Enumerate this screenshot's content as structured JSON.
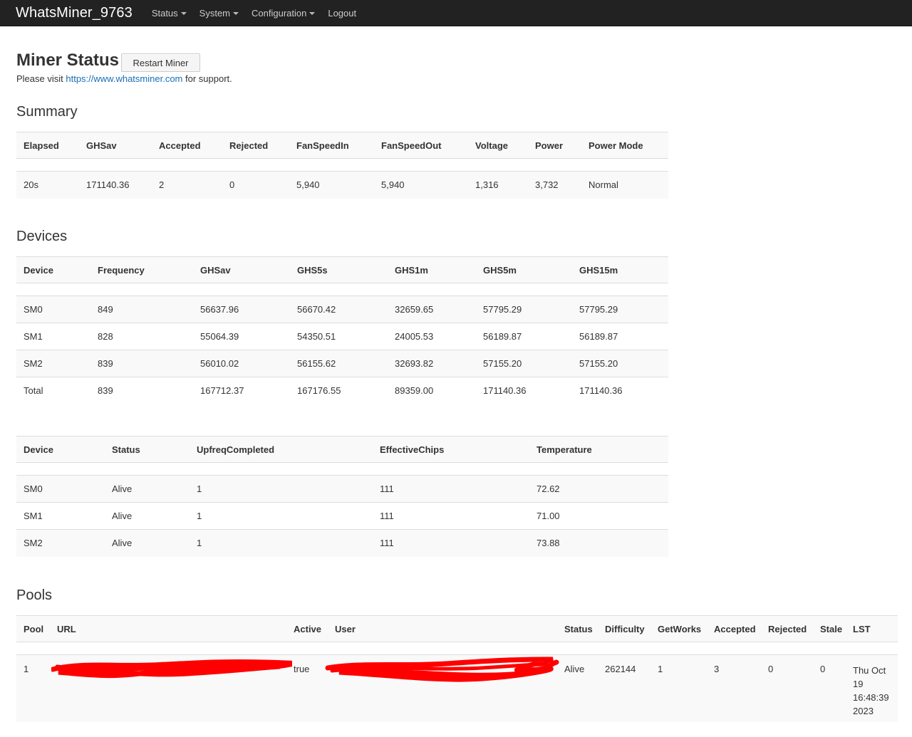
{
  "navbar": {
    "brand": "WhatsMiner_9763",
    "menu": [
      {
        "label": "Status",
        "dropdown": true
      },
      {
        "label": "System",
        "dropdown": true
      },
      {
        "label": "Configuration",
        "dropdown": true
      },
      {
        "label": "Logout",
        "dropdown": false
      }
    ]
  },
  "header": {
    "title": "Miner Status",
    "restart_label": "Restart Miner",
    "support_prefix": "Please visit ",
    "support_link": "https://www.whatsminer.com",
    "support_suffix": " for support."
  },
  "summary": {
    "title": "Summary",
    "columns": [
      "Elapsed",
      "GHSav",
      "Accepted",
      "Rejected",
      "FanSpeedIn",
      "FanSpeedOut",
      "Voltage",
      "Power",
      "Power Mode"
    ],
    "rows": [
      [
        "20s",
        "171140.36",
        "2",
        "0",
        "5,940",
        "5,940",
        "1,316",
        "3,732",
        "Normal"
      ]
    ]
  },
  "devices": {
    "title": "Devices",
    "columns": [
      "Device",
      "Frequency",
      "GHSav",
      "GHS5s",
      "GHS1m",
      "GHS5m",
      "GHS15m"
    ],
    "rows": [
      [
        "SM0",
        "849",
        "56637.96",
        "56670.42",
        "32659.65",
        "57795.29",
        "57795.29"
      ],
      [
        "SM1",
        "828",
        "55064.39",
        "54350.51",
        "24005.53",
        "56189.87",
        "56189.87"
      ],
      [
        "SM2",
        "839",
        "56010.02",
        "56155.62",
        "32693.82",
        "57155.20",
        "57155.20"
      ],
      [
        "Total",
        "839",
        "167712.37",
        "167176.55",
        "89359.00",
        "171140.36",
        "171140.36"
      ]
    ]
  },
  "device_status": {
    "columns": [
      "Device",
      "Status",
      "UpfreqCompleted",
      "EffectiveChips",
      "Temperature"
    ],
    "rows": [
      [
        "SM0",
        "Alive",
        "1",
        "111",
        "72.62"
      ],
      [
        "SM1",
        "Alive",
        "1",
        "111",
        "71.00"
      ],
      [
        "SM2",
        "Alive",
        "1",
        "111",
        "73.88"
      ]
    ]
  },
  "pools": {
    "title": "Pools",
    "columns": [
      "Pool",
      "URL",
      "Active",
      "User",
      "Status",
      "Difficulty",
      "GetWorks",
      "Accepted",
      "Rejected",
      "Stale",
      "LST"
    ],
    "rows": [
      {
        "pool": "1",
        "active": "true",
        "status": "Alive",
        "difficulty": "262144",
        "getworks": "1",
        "accepted": "3",
        "rejected": "0",
        "stale": "0",
        "lst": [
          "Thu Oct",
          "19",
          "16:48:39",
          "2023"
        ]
      }
    ],
    "redaction_color": "#ff0000"
  }
}
